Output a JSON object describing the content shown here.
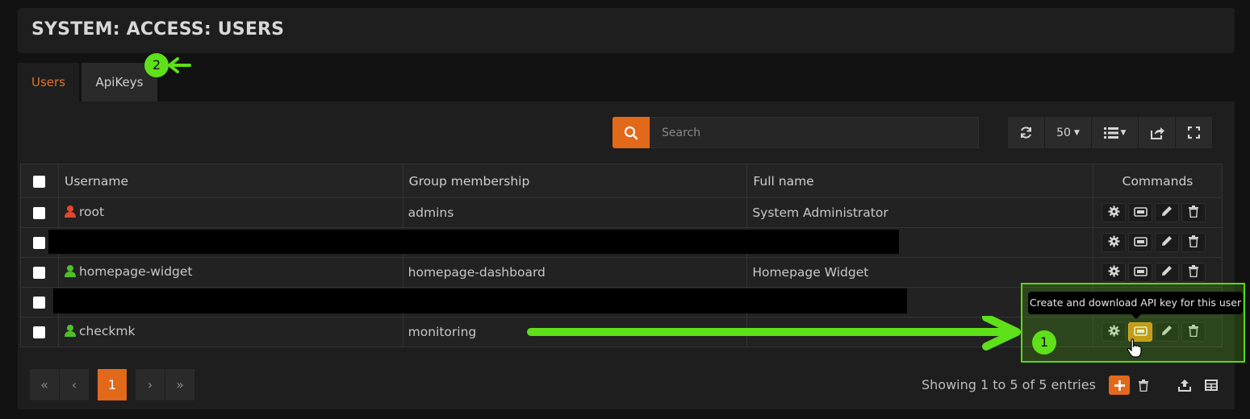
{
  "page": {
    "title": "SYSTEM: ACCESS: USERS"
  },
  "tabs": [
    {
      "label": "Users",
      "active": true
    },
    {
      "label": "ApiKeys",
      "active": false
    }
  ],
  "search": {
    "placeholder": "Search",
    "value": ""
  },
  "toolbar": {
    "page_size": "50"
  },
  "table": {
    "columns": [
      "Username",
      "Group membership",
      "Full name",
      "Commands"
    ],
    "rows": [
      {
        "username": "root",
        "group": "admins",
        "fullname": "System Administrator",
        "icon_color": "#e0492e",
        "redacted": false
      },
      {
        "username": "",
        "group": "",
        "fullname": "",
        "icon_color": "",
        "redacted": true
      },
      {
        "username": "homepage-widget",
        "group": "homepage-dashboard",
        "fullname": "Homepage Widget",
        "icon_color": "#4fbf28",
        "redacted": false
      },
      {
        "username": "",
        "group": "",
        "fullname": "",
        "icon_color": "",
        "redacted": true
      },
      {
        "username": "checkmk",
        "group": "monitoring",
        "fullname": "",
        "icon_color": "#4fbf28",
        "redacted": false
      }
    ]
  },
  "tooltip": {
    "text": "Create and download API key for this user"
  },
  "pagination": {
    "first": "«",
    "prev": "‹",
    "current": "1",
    "next": "›",
    "last": "»"
  },
  "footer": {
    "info": "Showing 1 to 5 of 5 entries"
  },
  "annotations": {
    "badge1": "1",
    "badge2": "2"
  },
  "colors": {
    "accent": "#e2691a",
    "highlight": "#5ee01a"
  },
  "icons": {
    "search": "search-icon",
    "refresh": "refresh-icon",
    "list": "list-icon",
    "export": "export-icon",
    "fullscreen": "fullscreen-icon",
    "cmd": [
      "gear-icon",
      "key-icon",
      "pencil-icon",
      "trash-icon"
    ]
  }
}
